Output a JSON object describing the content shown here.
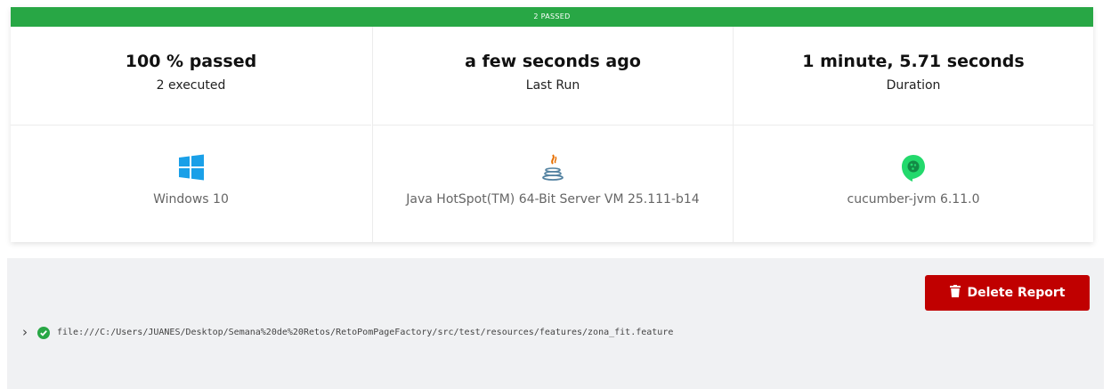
{
  "header": {
    "status_text": "2 PASSED",
    "status_color": "#28a745"
  },
  "summary": {
    "passed": {
      "value": "100 % passed",
      "label": "2 executed"
    },
    "last_run": {
      "value": "a few seconds ago",
      "label": "Last Run"
    },
    "duration": {
      "value": "1 minute, 5.71 seconds",
      "label": "Duration"
    }
  },
  "environment": {
    "os": {
      "icon": "windows-icon",
      "text": "Windows 10"
    },
    "java": {
      "icon": "java-icon",
      "text": "Java HotSpot(TM) 64-Bit Server VM 25.111-b14"
    },
    "cucumber": {
      "icon": "cucumber-icon",
      "text": "cucumber-jvm 6.11.0"
    }
  },
  "actions": {
    "delete_label": "Delete Report",
    "delete_color": "#c00000"
  },
  "features": [
    {
      "status_icon": "check-circle-icon",
      "path": "file:///C:/Users/JUANES/Desktop/Semana%20de%20Retos/RetoPomPageFactory/src/test/resources/features/zona_fit.feature"
    }
  ]
}
